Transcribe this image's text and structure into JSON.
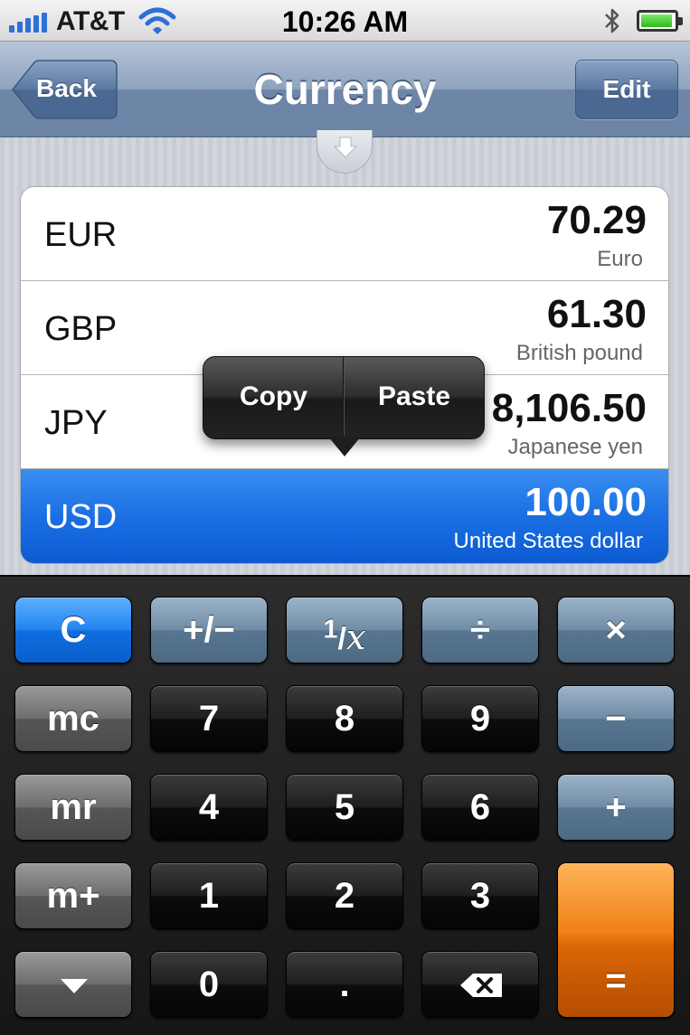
{
  "status_bar": {
    "carrier": "AT&T",
    "time": "10:26 AM",
    "battery_level": 0.95,
    "icons": [
      "signal-icon",
      "wifi-icon",
      "bluetooth-icon",
      "battery-icon"
    ]
  },
  "nav": {
    "title": "Currency",
    "back_label": "Back",
    "edit_label": "Edit"
  },
  "currencies": [
    {
      "code": "EUR",
      "value": "70.29",
      "name": "Euro"
    },
    {
      "code": "GBP",
      "value": "61.30",
      "name": "British pound"
    },
    {
      "code": "JPY",
      "value": "8,106.50",
      "name": "Japanese yen"
    },
    {
      "code": "USD",
      "value": "100.00",
      "name": "United States dollar",
      "selected": true
    }
  ],
  "edit_menu": {
    "copy_label": "Copy",
    "paste_label": "Paste"
  },
  "keypad": {
    "clear": "C",
    "sign": "+/−",
    "reciprocal_num": "1",
    "reciprocal_den": "x",
    "divide": "÷",
    "multiply": "×",
    "mc": "mc",
    "mr": "mr",
    "m_plus": "m+",
    "minus": "−",
    "plus": "+",
    "equals": "=",
    "decimal": ".",
    "digits": {
      "0": "0",
      "1": "1",
      "2": "2",
      "3": "3",
      "4": "4",
      "5": "5",
      "6": "6",
      "7": "7",
      "8": "8",
      "9": "9"
    }
  },
  "colors": {
    "accent_blue": "#1a6fe3",
    "equals_orange": "#f07f16",
    "nav_blue": "#6d85a6"
  }
}
